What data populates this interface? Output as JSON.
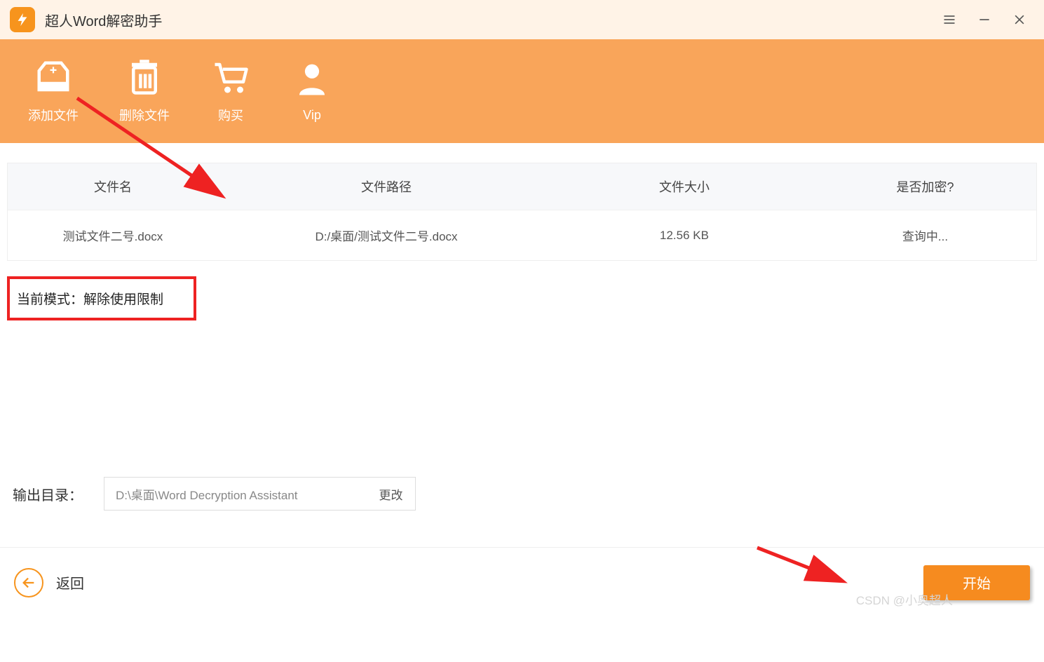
{
  "app": {
    "title": "超人Word解密助手"
  },
  "toolbar": {
    "add_file": "添加文件",
    "delete_file": "删除文件",
    "buy": "购买",
    "vip": "Vip"
  },
  "table": {
    "headers": {
      "name": "文件名",
      "path": "文件路径",
      "size": "文件大小",
      "encrypted": "是否加密?"
    },
    "rows": [
      {
        "name": "测试文件二号.docx",
        "path": "D:/桌面/测试文件二号.docx",
        "size": "12.56 KB",
        "encrypted": "查询中..."
      }
    ]
  },
  "mode": {
    "text": "当前模式：解除使用限制"
  },
  "output": {
    "label": "输出目录：",
    "path": "D:\\桌面\\Word Decryption Assistant",
    "change": "更改"
  },
  "footer": {
    "back": "返回",
    "start": "开始"
  },
  "watermark": "CSDN @小奥超人"
}
